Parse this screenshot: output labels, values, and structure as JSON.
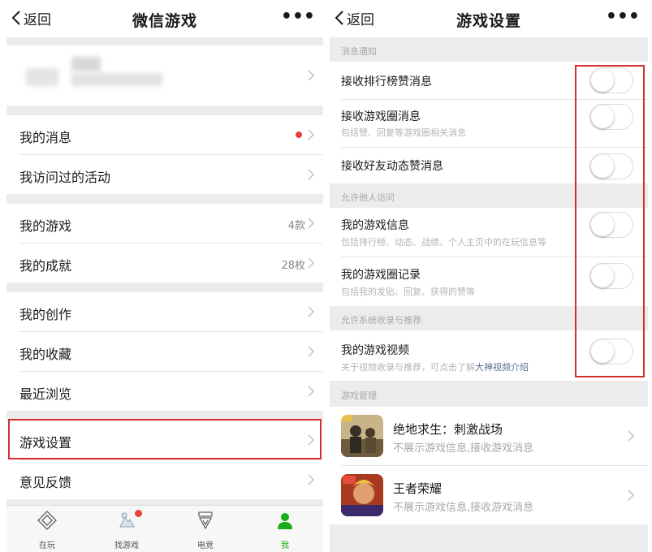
{
  "left": {
    "nav": {
      "back_label": "返回",
      "title": "微信游戏",
      "more": "•••"
    },
    "menu": {
      "my_messages": "我的消息",
      "visited_activities": "我访问过的活动",
      "my_games": "我的游戏",
      "my_games_count": "4款",
      "my_achievements": "我的成就",
      "my_achievements_count": "28枚",
      "my_creations": "我的创作",
      "my_favorites": "我的收藏",
      "recently_viewed": "最近浏览",
      "game_settings": "游戏设置",
      "feedback": "意见反馈"
    },
    "tabs": [
      {
        "label": "在玩",
        "icon": "play-icon"
      },
      {
        "label": "找游戏",
        "icon": "find-game-icon"
      },
      {
        "label": "电竞",
        "icon": "esports-icon"
      },
      {
        "label": "我",
        "icon": "me-icon"
      }
    ]
  },
  "right": {
    "nav": {
      "back_label": "返回",
      "title": "游戏设置",
      "more": "•••"
    },
    "sections": {
      "notifications": "消息通知",
      "allow_others": "允许他人访问",
      "allow_system": "允许系统收录与推荐",
      "game_management": "游戏管理"
    },
    "settings": {
      "leaderboard_likes": {
        "label": "接收排行榜赞消息",
        "on": false
      },
      "game_circle": {
        "label": "接收游戏圈消息",
        "sub": "包括赞、回复等游戏圈相关消息",
        "on": false
      },
      "friend_activity_likes": {
        "label": "接收好友动态赞消息",
        "on": false
      },
      "game_info": {
        "label": "我的游戏信息",
        "sub": "包括排行榜、动态、战绩、个人主页中的在玩信息等",
        "on": false
      },
      "circle_records": {
        "label": "我的游戏圈记录",
        "sub": "包括我的发贴、回复、获得的赞等",
        "on": false
      },
      "game_videos": {
        "label": "我的游戏视频",
        "sub": "关于视频收录与推荐，可点击了解",
        "sub_link": "大神视频介绍",
        "on": false
      }
    },
    "games": [
      {
        "name": "绝地求生：刺激战场",
        "desc": "不展示游戏信息,接收游戏消息",
        "icon": "pubg-game-icon"
      },
      {
        "name": "王者荣耀",
        "desc": "不展示游戏信息,接收游戏消息",
        "icon": "honor-of-kings-game-icon"
      }
    ]
  },
  "colors": {
    "highlight": "#d32f2f",
    "badge_red": "#e64340",
    "active_green": "#1aad19",
    "link_blue": "#576b95",
    "section_gray": "#ececec"
  }
}
